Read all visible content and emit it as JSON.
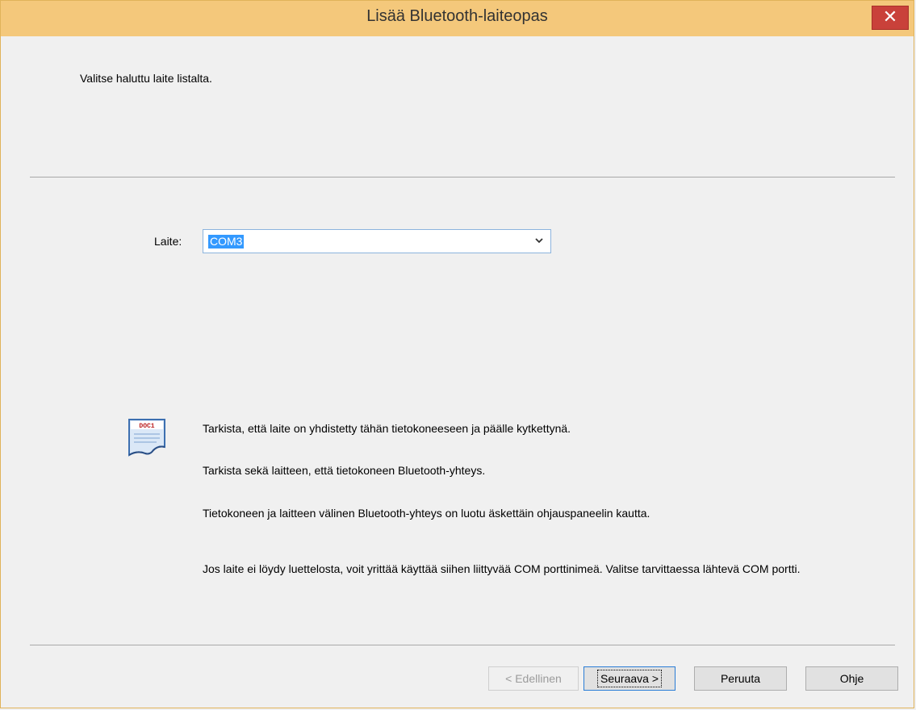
{
  "window": {
    "title": "Lisää Bluetooth-laiteopas",
    "close_label": "✕"
  },
  "main": {
    "instruction": "Valitse haluttu laite listalta.",
    "device_label": "Laite:",
    "device_select": {
      "value": "COM3"
    },
    "hints": [
      "Tarkista, että laite on yhdistetty tähän tietokoneeseen ja päälle kytkettynä.",
      "Tarkista sekä laitteen, että tietokoneen Bluetooth-yhteys.",
      "Tietokoneen ja laitteen välinen Bluetooth-yhteys on luotu äskettäin ohjauspaneelin kautta.",
      "Jos laite ei löydy luettelosta, voit yrittää käyttää siihen liittyvää COM porttinimeä. Valitse tarvittaessa lähtevä COM portti."
    ],
    "doc_icon": {
      "name": "document-icon",
      "text": "DOC1"
    }
  },
  "buttons": {
    "back": "< Edellinen",
    "next": "Seuraava >",
    "cancel": "Peruuta",
    "help": "Ohje"
  },
  "colors": {
    "titlebar": "#f4c87b",
    "close": "#c9413a",
    "selection": "#3399ff"
  }
}
